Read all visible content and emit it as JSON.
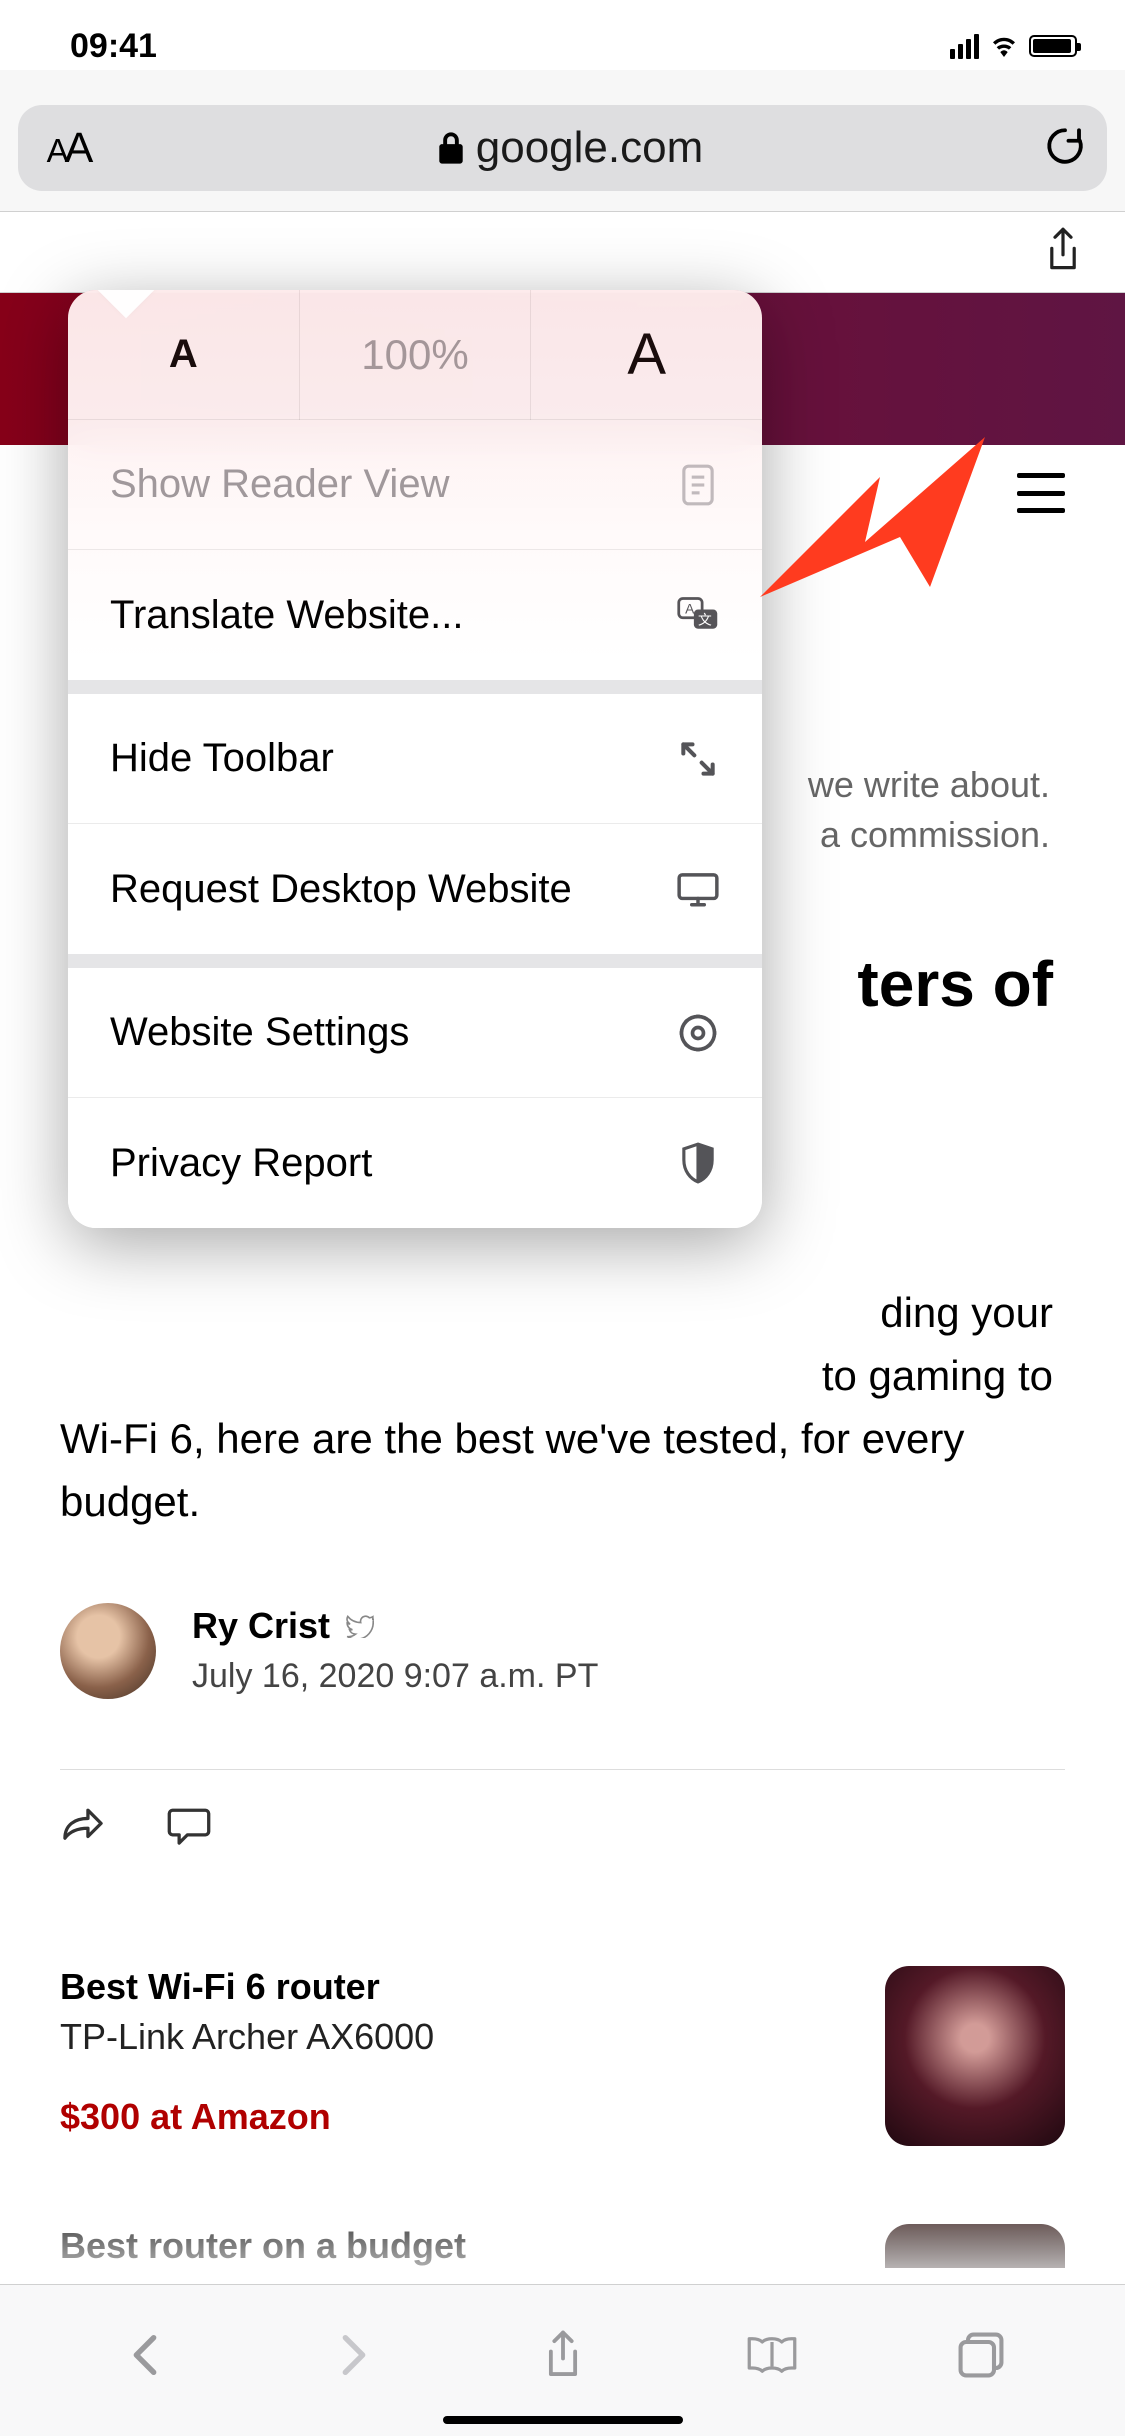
{
  "status": {
    "time": "09:41"
  },
  "urlbar": {
    "domain": "google.com",
    "zoom": "100%"
  },
  "popover": {
    "reader": "Show Reader View",
    "translate": "Translate Website...",
    "hide_toolbar": "Hide Toolbar",
    "desktop": "Request Desktop Website",
    "settings": "Website Settings",
    "privacy": "Privacy Report"
  },
  "page": {
    "disclosure_l1": "we write about.",
    "disclosure_l2": "a commission.",
    "headline_frag": "ters of",
    "deck": "ding your to gaming to Wi-Fi 6, here are the best we've tested, for every budget.",
    "deck_part1": "ding your",
    "deck_part2": "to gaming to",
    "deck_full": "Wi-Fi 6, here are the best we've tested, for every budget.",
    "author": "Ry Crist",
    "pubdate": "July 16, 2020 9:07 a.m. PT",
    "product1": {
      "title": "Best Wi-Fi 6 router",
      "name": "TP-Link Archer AX6000",
      "price": "$300 at Amazon"
    },
    "product2": {
      "title": "Best router on a budget"
    }
  }
}
